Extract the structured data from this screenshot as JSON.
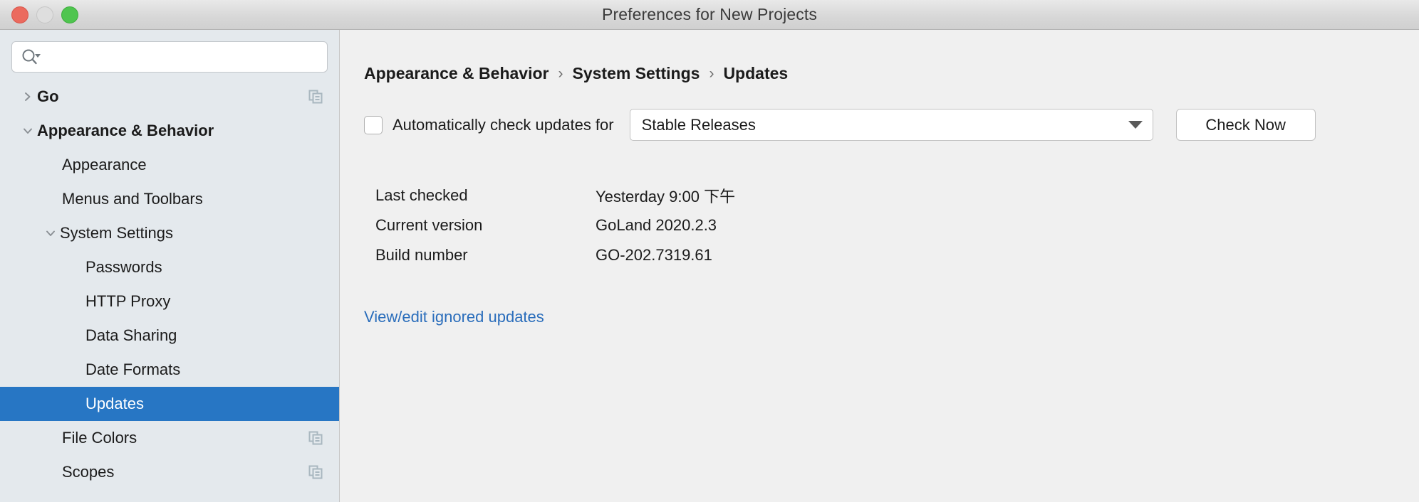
{
  "window": {
    "title": "Preferences for New Projects",
    "traffic_lights": [
      "close",
      "minimize",
      "maximize"
    ]
  },
  "sidebar": {
    "search": {
      "value": "",
      "placeholder": ""
    },
    "items": [
      {
        "label": "Go",
        "indent": 0,
        "twisty": "collapsed",
        "bold": true,
        "selected": false,
        "copy_icon": true
      },
      {
        "label": "Appearance & Behavior",
        "indent": 0,
        "twisty": "expanded",
        "bold": true,
        "selected": false,
        "copy_icon": false
      },
      {
        "label": "Appearance",
        "indent": 1,
        "twisty": "none",
        "bold": false,
        "selected": false,
        "copy_icon": false
      },
      {
        "label": "Menus and Toolbars",
        "indent": 1,
        "twisty": "none",
        "bold": false,
        "selected": false,
        "copy_icon": false
      },
      {
        "label": "System Settings",
        "indent": 1,
        "twisty": "expanded",
        "bold": false,
        "selected": false,
        "copy_icon": false
      },
      {
        "label": "Passwords",
        "indent": 2,
        "twisty": "none",
        "bold": false,
        "selected": false,
        "copy_icon": false
      },
      {
        "label": "HTTP Proxy",
        "indent": 2,
        "twisty": "none",
        "bold": false,
        "selected": false,
        "copy_icon": false
      },
      {
        "label": "Data Sharing",
        "indent": 2,
        "twisty": "none",
        "bold": false,
        "selected": false,
        "copy_icon": false
      },
      {
        "label": "Date Formats",
        "indent": 2,
        "twisty": "none",
        "bold": false,
        "selected": false,
        "copy_icon": false
      },
      {
        "label": "Updates",
        "indent": 2,
        "twisty": "none",
        "bold": false,
        "selected": true,
        "copy_icon": false
      },
      {
        "label": "File Colors",
        "indent": 1,
        "twisty": "none",
        "bold": false,
        "selected": false,
        "copy_icon": true
      },
      {
        "label": "Scopes",
        "indent": 1,
        "twisty": "none",
        "bold": false,
        "selected": false,
        "copy_icon": true
      }
    ]
  },
  "content": {
    "breadcrumb": [
      "Appearance & Behavior",
      "System Settings",
      "Updates"
    ],
    "breadcrumb_separator": "›",
    "auto_check": {
      "checked": false,
      "label": "Automatically check updates for",
      "channel_selected": "Stable Releases",
      "check_now_label": "Check Now"
    },
    "info_rows": [
      {
        "key": "Last checked",
        "value": "Yesterday 9:00 下午"
      },
      {
        "key": "Current version",
        "value": "GoLand 2020.2.3"
      },
      {
        "key": "Build number",
        "value": "GO-202.7319.61"
      }
    ],
    "ignored_updates_link": "View/edit ignored updates"
  },
  "colors": {
    "selection_blue": "#2776c4",
    "link_blue": "#2a6dbb",
    "sidebar_bg": "#e4e9ed",
    "content_bg": "#f0f0f0",
    "copy_icon": "#a9b7c0"
  }
}
